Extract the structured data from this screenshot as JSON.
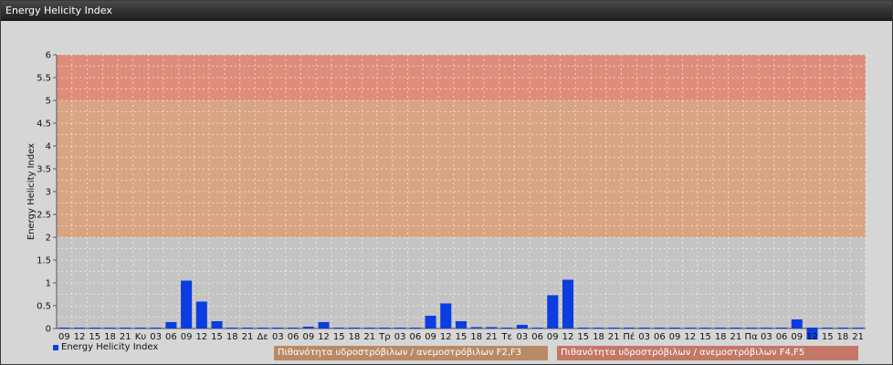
{
  "window": {
    "title": "Energy Helicity Index"
  },
  "legend": {
    "series_label": "Energy Helicity Index",
    "band_f2f3": "Πιθανότητα υδροστρόβιλων / ανεμοστρόβιλων F2,F3",
    "band_f4f5": "Πιθανότητα υδροστρόβιλων / ανεμοστρόβιλων F4,F5"
  },
  "colors": {
    "bar": "#0b3de0",
    "band_low": "#c2c2c2",
    "band_f2f3": "#d8a07a",
    "band_f4f5": "#e08570",
    "legend_f2f3": "#b98a67",
    "legend_f4f5": "#c37767"
  },
  "chart_data": {
    "type": "bar",
    "title": "",
    "ylabel": "Energy Helicity Index",
    "xlabel": "",
    "ylim": [
      0,
      6
    ],
    "yticks": [
      "0",
      "0.5",
      "1",
      "1.5",
      "2",
      "2.5",
      "3",
      "3.5",
      "4",
      "4.5",
      "5",
      "5.5",
      "6"
    ],
    "grid": true,
    "legend_position": "bottom-left",
    "bands": [
      {
        "from": 0,
        "to": 2,
        "label": ""
      },
      {
        "from": 2,
        "to": 5,
        "label": "Πιθανότητα υδροστρόβιλων / ανεμοστρόβιλων F2,F3"
      },
      {
        "from": 5,
        "to": 6,
        "label": "Πιθανότητα υδροστρόβιλων / ανεμοστρόβιλων F4,F5"
      }
    ],
    "categories": [
      "09",
      "12",
      "15",
      "18",
      "21",
      "Κυ",
      "03",
      "06",
      "09",
      "12",
      "15",
      "18",
      "21",
      "Δε",
      "03",
      "06",
      "09",
      "12",
      "15",
      "18",
      "21",
      "Τρ",
      "03",
      "06",
      "09",
      "12",
      "15",
      "18",
      "21",
      "Τε",
      "03",
      "06",
      "09",
      "12",
      "15",
      "18",
      "21",
      "Πέ",
      "03",
      "06",
      "09",
      "12",
      "15",
      "18",
      "21",
      "Πα",
      "03",
      "06",
      "09",
      "12",
      "15",
      "18",
      "21"
    ],
    "series": [
      {
        "name": "Energy Helicity Index",
        "values": [
          0.02,
          0.02,
          0.02,
          0.02,
          0.02,
          0.02,
          0.02,
          0.14,
          1.05,
          0.59,
          0.16,
          0.02,
          0.02,
          0.02,
          0.02,
          0.02,
          0.04,
          0.14,
          0.02,
          0.02,
          0.02,
          0.02,
          0.02,
          0.02,
          0.28,
          0.55,
          0.16,
          0.03,
          0.03,
          0.02,
          0.08,
          0.02,
          0.73,
          1.07,
          0.02,
          0.02,
          0.02,
          0.02,
          0.02,
          0.02,
          0.02,
          0.02,
          0.02,
          0.02,
          0.02,
          0.02,
          0.02,
          0.02,
          0.2,
          0.02,
          0.02,
          0.02,
          0.02
        ]
      }
    ]
  }
}
